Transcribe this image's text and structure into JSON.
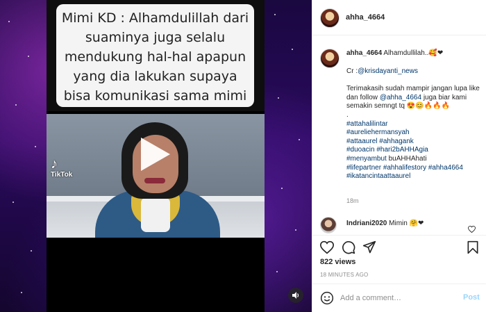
{
  "post": {
    "username": "ahha_4664",
    "caption_line": "Alhamdullilah..🥰❤",
    "credit_prefix": "Cr :",
    "credit_handle": "@krisdayanti_news",
    "body_start": "Terimakasih sudah mampir jangan lupa like dan follow",
    "body_handle": "@ahha_4664",
    "body_end": "juga biar kami semakin semngt tq 😍😊🔥🔥🔥",
    "dot": ".",
    "hashtags": [
      "#attahalilintar",
      "#aureliehermansyah",
      "#attaaurel",
      "#ahhagank",
      "#duoacin",
      "#hari2bAHHAgia",
      "#menyambut",
      "buAHHAhati",
      "#lifepartner",
      "#ahhalifestory",
      "#ahha4664",
      "#ikatancintaattaaurel"
    ],
    "time": "18m"
  },
  "video": {
    "overlay_text": "Mimi KD : Alhamdulillah dari suaminya juga selalu mendukung hal-hal apapun yang dia lakukan supaya bisa komunikasi sama mimi",
    "watermark": "TikTok"
  },
  "comment": {
    "username": "Indriani2020",
    "text": "Mimin 🤗❤"
  },
  "stats": {
    "views": "822 views",
    "timestamp": "18 MINUTES AGO"
  },
  "composer": {
    "placeholder": "Add a comment…",
    "post_label": "Post"
  },
  "icons": {
    "like": "heart-icon",
    "comment": "comment-icon",
    "share": "paper-plane-icon",
    "save": "bookmark-icon",
    "emoji": "smiley-icon",
    "sound": "speaker-icon",
    "play": "play-icon"
  },
  "colors": {
    "link": "#00376b",
    "post_button": "#0095f6",
    "muted": "#8e8e8e"
  }
}
